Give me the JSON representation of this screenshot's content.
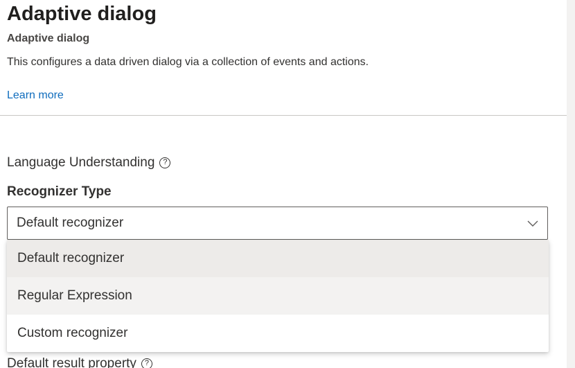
{
  "header": {
    "title": "Adaptive dialog",
    "subtitle": "Adaptive dialog",
    "description": "This configures a data driven dialog via a collection of events and actions.",
    "learn_more": "Learn more"
  },
  "section": {
    "label": "Language Understanding",
    "help_icon": "?"
  },
  "recognizer": {
    "label": "Recognizer Type",
    "selected_value": "Default recognizer",
    "options": [
      "Default recognizer",
      "Regular Expression",
      "Custom recognizer"
    ]
  },
  "next_field": {
    "label": "Default result property",
    "help_icon": "?"
  },
  "colors": {
    "link": "#0f6cbd",
    "selected_option_bg": "#edebe9",
    "hover_option_bg": "#f3f2f1"
  }
}
